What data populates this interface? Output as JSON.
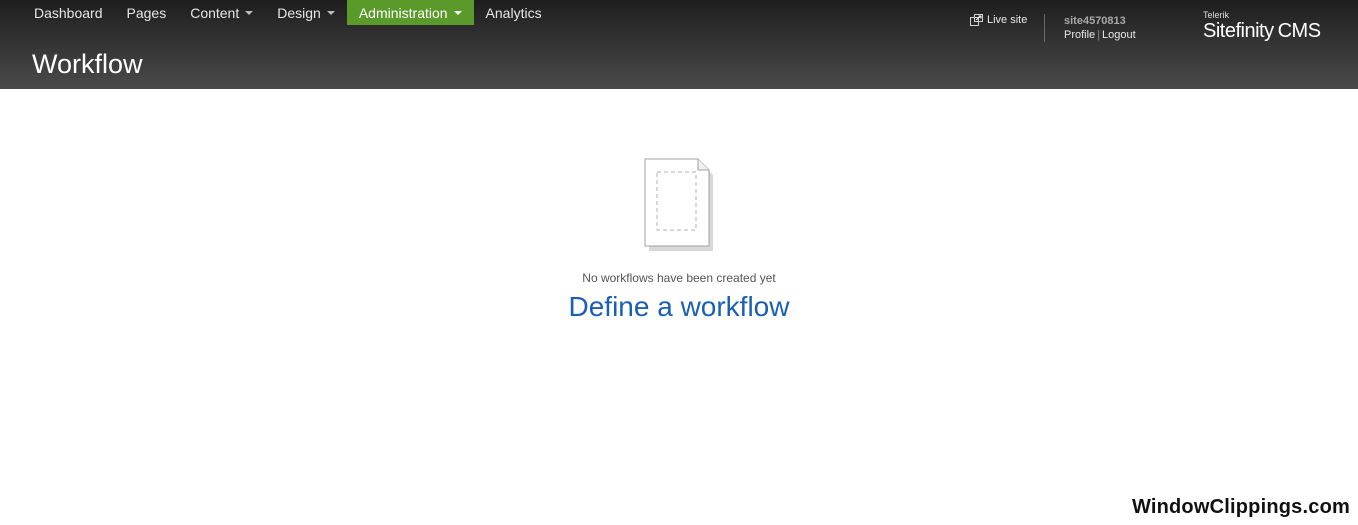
{
  "nav": {
    "items": [
      {
        "label": "Dashboard",
        "dropdown": false,
        "active": false
      },
      {
        "label": "Pages",
        "dropdown": false,
        "active": false
      },
      {
        "label": "Content",
        "dropdown": true,
        "active": false
      },
      {
        "label": "Design",
        "dropdown": true,
        "active": false
      },
      {
        "label": "Administration",
        "dropdown": true,
        "active": true
      },
      {
        "label": "Analytics",
        "dropdown": false,
        "active": false
      }
    ]
  },
  "header": {
    "page_title": "Workflow",
    "live_site_label": "Live site",
    "username": "site4570813",
    "profile_label": "Profile",
    "separator": "|",
    "logout_label": "Logout",
    "brand_vendor": "Telerik",
    "brand_name": "Sitefinity",
    "brand_suffix": "CMS"
  },
  "main": {
    "empty_message": "No workflows have been created yet",
    "define_link": "Define a workflow"
  },
  "watermark": "WindowClippings.com",
  "colors": {
    "active_nav": "#5a9a2a",
    "link": "#1a5fb4",
    "header_top": "#1e1e1e",
    "header_bottom": "#4a4a4a"
  },
  "icons": {
    "live_site": "external-link-icon",
    "empty_state": "document-icon",
    "dropdown": "caret-down-icon"
  }
}
